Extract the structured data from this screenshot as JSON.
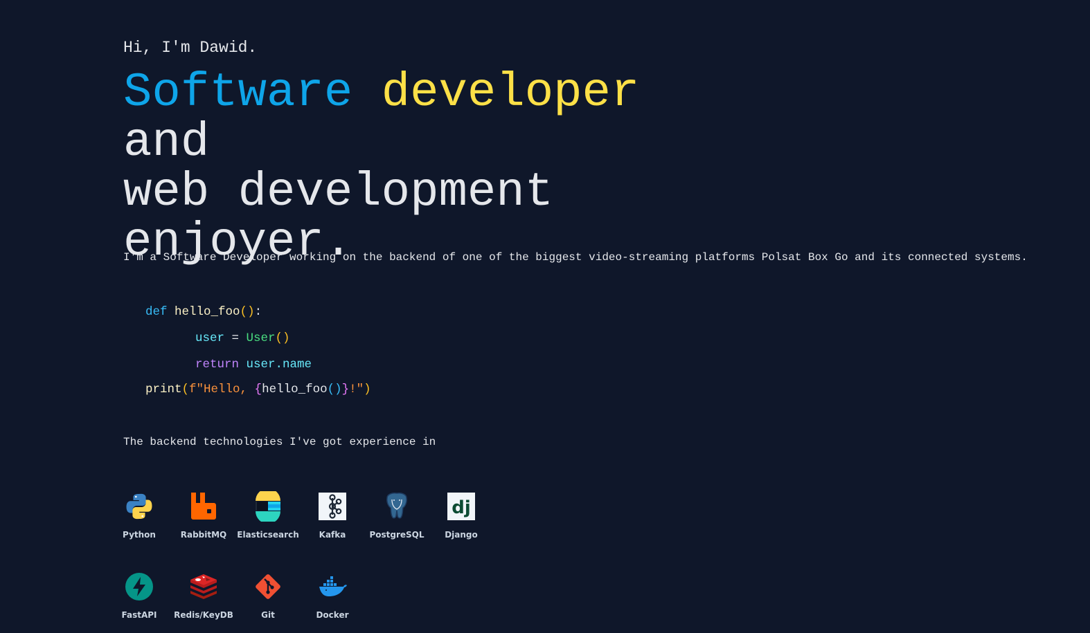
{
  "greeting": "Hi, I'm Dawid.",
  "hero": {
    "word1": "Software",
    "word2": "developer",
    "word3": "and",
    "line2": "web development",
    "line3": "enjoyer."
  },
  "intro": "I'm a Software Developer working on the backend of one of the biggest video-streaming platforms Polsat Box Go and its connected systems.",
  "code": {
    "def": "def",
    "fn_name": "hello_foo",
    "open_paren": "(",
    "close_paren": ")",
    "colon": ":",
    "var": "user",
    "assign": " = ",
    "cls": "User",
    "cls_parens": "()",
    "return_kw": "return",
    "return_val": "user.name",
    "print": "print",
    "print_open": "(",
    "fstr_open": "f\"Hello, ",
    "brace_open": "{",
    "inner_call": "hello_foo",
    "inner_parens": "()",
    "brace_close": "}",
    "fstr_close": "!\"",
    "print_close": ")"
  },
  "tech_intro": "The backend technologies I've got experience in",
  "technologies": [
    {
      "label": "Python",
      "icon": "python-icon"
    },
    {
      "label": "RabbitMQ",
      "icon": "rabbitmq-icon"
    },
    {
      "label": "Elasticsearch",
      "icon": "elasticsearch-icon"
    },
    {
      "label": "Kafka",
      "icon": "kafka-icon"
    },
    {
      "label": "PostgreSQL",
      "icon": "postgresql-icon"
    },
    {
      "label": "Django",
      "icon": "django-icon"
    },
    {
      "label": "FastAPI",
      "icon": "fastapi-icon"
    },
    {
      "label": "Redis/KeyDB",
      "icon": "redis-icon"
    },
    {
      "label": "Git",
      "icon": "git-icon"
    },
    {
      "label": "Docker",
      "icon": "docker-icon"
    }
  ],
  "colors": {
    "background": "#0f172a",
    "accent_blue": "#0ea5e9",
    "accent_yellow": "#fde047"
  }
}
